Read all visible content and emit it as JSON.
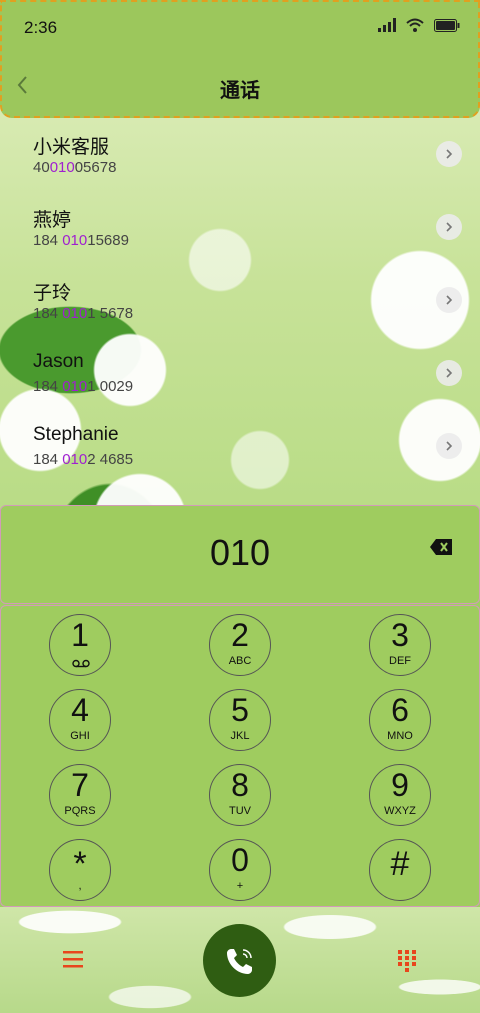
{
  "status_bar": {
    "time": "2:36"
  },
  "header": {
    "title": "通话"
  },
  "contacts": [
    {
      "name": "小米客服",
      "number_pre": "40",
      "number_match": "010",
      "number_post": "05678"
    },
    {
      "name": "燕婷",
      "number_pre": "184 ",
      "number_match": "010",
      "number_post": "15689"
    },
    {
      "name": "子玲",
      "number_pre": "184 ",
      "number_match": "010",
      "number_post": "1 5678"
    },
    {
      "name": "Jason",
      "number_pre": "184 ",
      "number_match": "010",
      "number_post": "1 0029"
    },
    {
      "name": "Stephanie",
      "number_pre": "184 ",
      "number_match": "010",
      "number_post": "2 4685"
    }
  ],
  "dialer": {
    "number": "010"
  },
  "keys": [
    {
      "digit": "1",
      "letters": ""
    },
    {
      "digit": "2",
      "letters": "ABC"
    },
    {
      "digit": "3",
      "letters": "DEF"
    },
    {
      "digit": "4",
      "letters": "GHI"
    },
    {
      "digit": "5",
      "letters": "JKL"
    },
    {
      "digit": "6",
      "letters": "MNO"
    },
    {
      "digit": "7",
      "letters": "PQRS"
    },
    {
      "digit": "8",
      "letters": "TUV"
    },
    {
      "digit": "9",
      "letters": "WXYZ"
    },
    {
      "digit": "*",
      "letters": ","
    },
    {
      "digit": "0",
      "letters": "+"
    },
    {
      "digit": "#",
      "letters": ""
    }
  ],
  "colors": {
    "highlight": "#a020d0",
    "call_button": "#2f5d12",
    "menu_icon": "#e8461c",
    "panel_border": "#d29bb8"
  },
  "icons": {
    "back": "chevron-left-icon",
    "backspace": "backspace-icon",
    "voicemail": "voicemail-icon",
    "menu": "menu-icon",
    "call": "phone-icon",
    "keypad": "keypad-grid-icon"
  }
}
